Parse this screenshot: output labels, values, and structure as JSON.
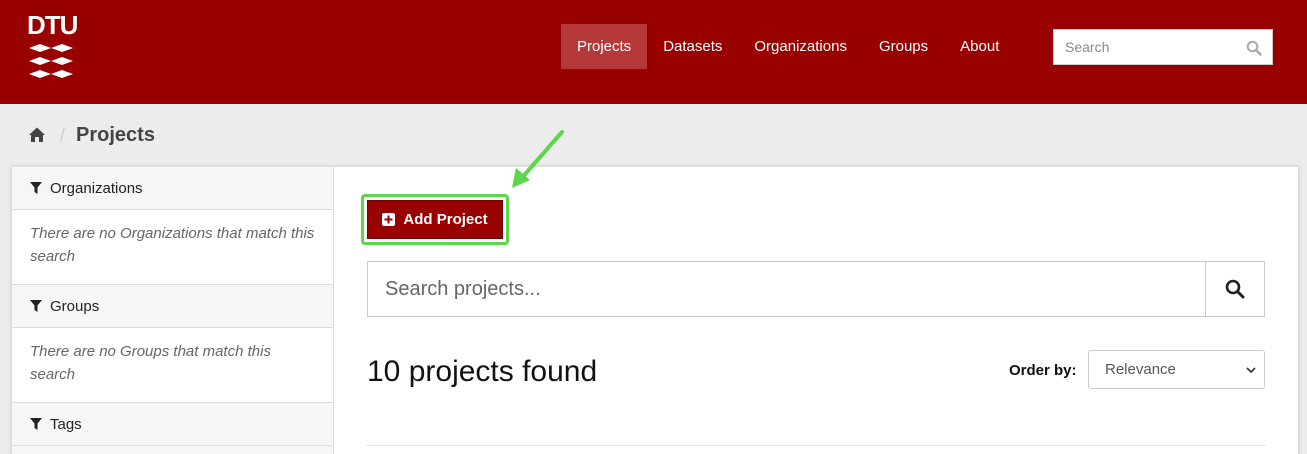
{
  "header": {
    "logo_text": "DTU",
    "nav": [
      {
        "label": "Projects",
        "active": true
      },
      {
        "label": "Datasets",
        "active": false
      },
      {
        "label": "Organizations",
        "active": false
      },
      {
        "label": "Groups",
        "active": false
      },
      {
        "label": "About",
        "active": false
      }
    ],
    "search_placeholder": "Search",
    "brand_color": "#990000"
  },
  "breadcrumb": {
    "home_icon": "home-icon",
    "title": "Projects"
  },
  "sidebar": {
    "facets": [
      {
        "label": "Organizations",
        "empty_text": "There are no Organizations that match this search"
      },
      {
        "label": "Groups",
        "empty_text": "There are no Groups that match this search"
      },
      {
        "label": "Tags",
        "empty_text": ""
      }
    ]
  },
  "main": {
    "add_button_label": "Add Project",
    "search_placeholder": "Search projects...",
    "results_text": "10 projects found",
    "order_label": "Order by:",
    "order_selected": "Relevance",
    "highlight_color": "#5cd64a"
  }
}
